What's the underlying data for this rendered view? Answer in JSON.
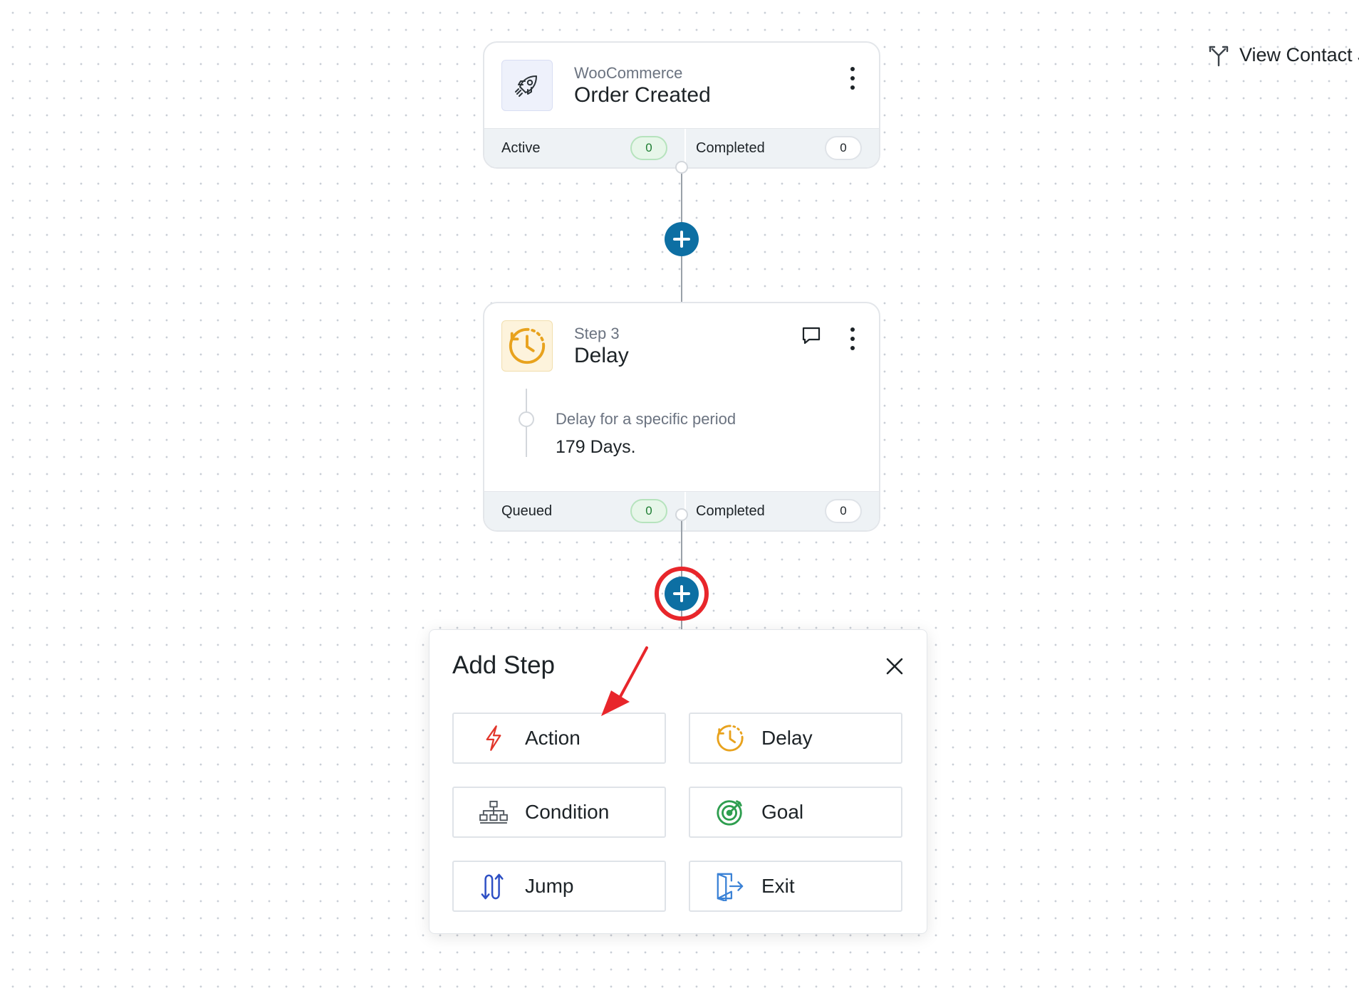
{
  "header": {
    "view_contact_label": "View Contact J"
  },
  "trigger_card": {
    "subtitle": "WooCommerce",
    "title": "Order Created",
    "stats": [
      {
        "label": "Active",
        "count": "0"
      },
      {
        "label": "Completed",
        "count": "0"
      }
    ]
  },
  "delay_card": {
    "subtitle": "Step 3",
    "title": "Delay",
    "description": "Delay for a specific period",
    "value": "179 Days.",
    "stats": [
      {
        "label": "Queued",
        "count": "0"
      },
      {
        "label": "Completed",
        "count": "0"
      }
    ]
  },
  "add_step": {
    "title": "Add Step",
    "options": [
      {
        "label": "Action",
        "icon": "lightning-icon"
      },
      {
        "label": "Delay",
        "icon": "clock-icon"
      },
      {
        "label": "Condition",
        "icon": "hierarchy-icon"
      },
      {
        "label": "Goal",
        "icon": "target-icon"
      },
      {
        "label": "Jump",
        "icon": "jump-icon"
      },
      {
        "label": "Exit",
        "icon": "exit-door-icon"
      }
    ]
  },
  "colors": {
    "accent_blue": "#0d6fa3",
    "highlight_red": "#e8262b",
    "active_green": "#1e7d32",
    "delay_orange": "#e8a21d"
  }
}
